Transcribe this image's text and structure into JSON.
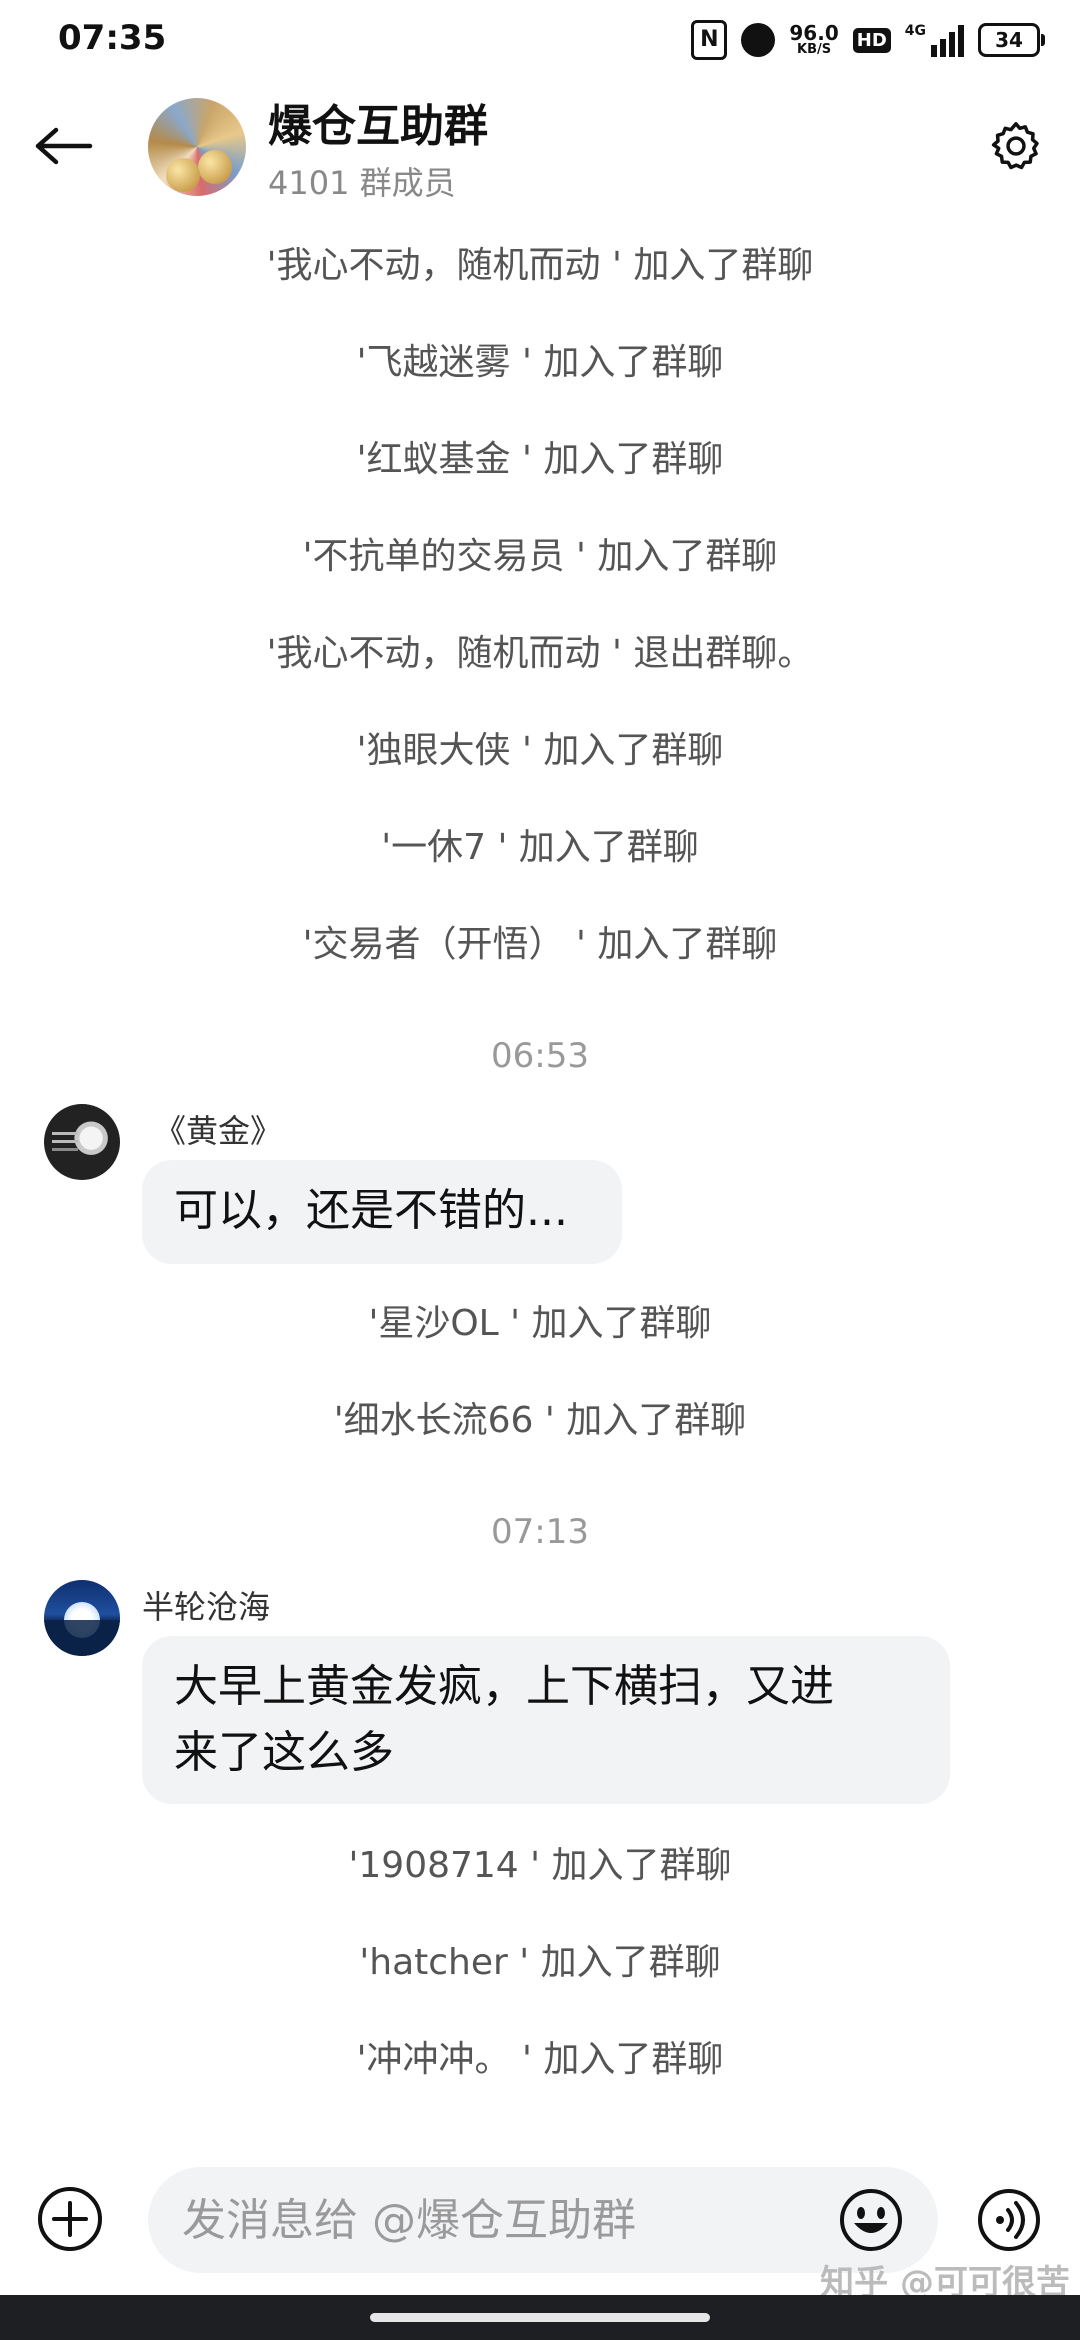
{
  "status_bar": {
    "time": "07:35",
    "nfc": "N",
    "net_speed_value": "96.0",
    "net_speed_unit": "KB/S",
    "hd": "HD",
    "network": "4G",
    "battery": "34"
  },
  "header": {
    "group_name": "爆仓互助群",
    "member_count": "4101 群成员"
  },
  "messages": {
    "sys_1": "'我心不动，随机而动 ' 加入了群聊",
    "sys_2": "'飞越迷雾 ' 加入了群聊",
    "sys_3": "'红蚁基金 ' 加入了群聊",
    "sys_4": "'不抗单的交易员 ' 加入了群聊",
    "sys_5": "'我心不动，随机而动 ' 退出群聊。",
    "sys_6": "'独眼大侠 ' 加入了群聊",
    "sys_7": "'一休7 ' 加入了群聊",
    "sys_8": "'交易者（开悟） ' 加入了群聊",
    "time_1": "06:53",
    "msg_1_sender": "《黄金》",
    "msg_1_text": "可以，还是不错的...",
    "sys_9": "'星沙OL ' 加入了群聊",
    "sys_10": "'细水长流66 ' 加入了群聊",
    "time_2": "07:13",
    "msg_2_sender": "半轮沧海",
    "msg_2_line1": "大早上黄金发疯，上下横扫，又进",
    "msg_2_line2": "来了这么多",
    "sys_11": "'1908714 ' 加入了群聊",
    "sys_12": "'hatcher ' 加入了群聊",
    "sys_13": "'冲冲冲。 ' 加入了群聊"
  },
  "input": {
    "placeholder": "发消息给 @爆仓互助群"
  },
  "watermark": "知乎 @可可很苦",
  "icons": [
    "back-arrow-icon",
    "settings-gear-icon",
    "add-circle-icon",
    "emoji-icon",
    "voice-icon"
  ]
}
